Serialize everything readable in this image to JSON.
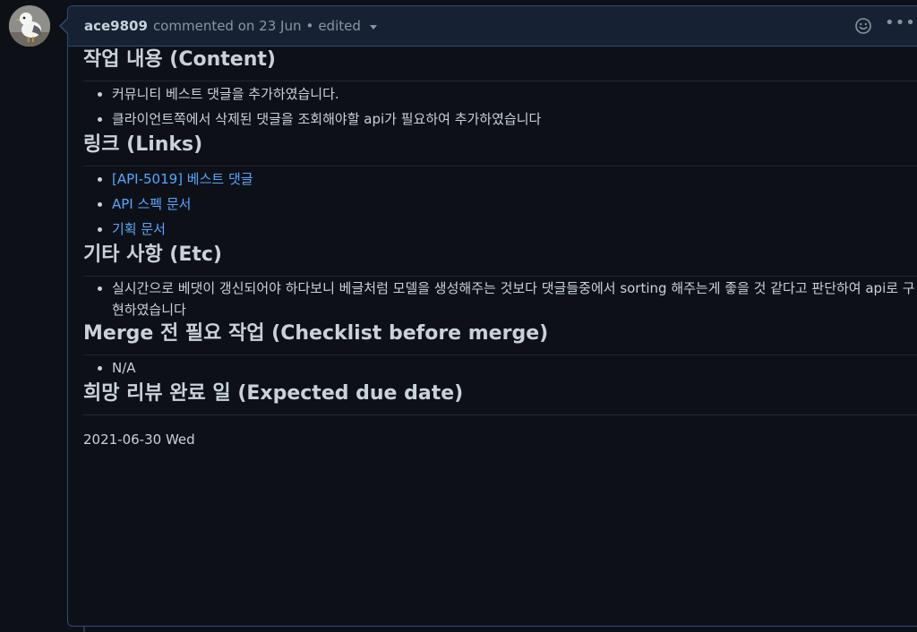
{
  "comment": {
    "author": "ace9809",
    "action_text": "commented on 23 Jun",
    "separator": "•",
    "edited_label": "edited",
    "more_label": "•••"
  },
  "sections": {
    "content": {
      "heading": "작업 내용 (Content)",
      "items": [
        "커뮤니티 베스트 댓글을 추가하였습니다.",
        "클라이언트쪽에서 삭제된 댓글을 조회해야할 api가 필요하여 추가하였습니다"
      ]
    },
    "links": {
      "heading": "링크 (Links)",
      "items": [
        "[API-5019] 베스트 댓글",
        "API 스펙 문서",
        "기획 문서"
      ]
    },
    "etc": {
      "heading": "기타 사항 (Etc)",
      "items": [
        "실시간으로 베댓이 갱신되어야 하다보니 베글처럼 모델을 생성해주는 것보다 댓글들중에서 sorting 해주는게 좋을 것 같다고 판단하여 api로 구현하였습니다"
      ]
    },
    "checklist": {
      "heading": "Merge 전 필요 작업 (Checklist before merge)",
      "items": [
        "N/A"
      ]
    },
    "due": {
      "heading": "희망 리뷰 완료 일 (Expected due date)",
      "text": "2021-06-30 Wed"
    }
  },
  "icons": {
    "avatar": "bird-avatar",
    "reaction": "smiley-icon",
    "more": "kebab-icon",
    "edited_dropdown": "chevron-down-icon"
  },
  "colors": {
    "background": "#0d1117",
    "header_background": "#162233",
    "border": "#2f4a73",
    "text": "#c9d1d9",
    "muted": "#8b949e",
    "link": "#58a6ff"
  }
}
